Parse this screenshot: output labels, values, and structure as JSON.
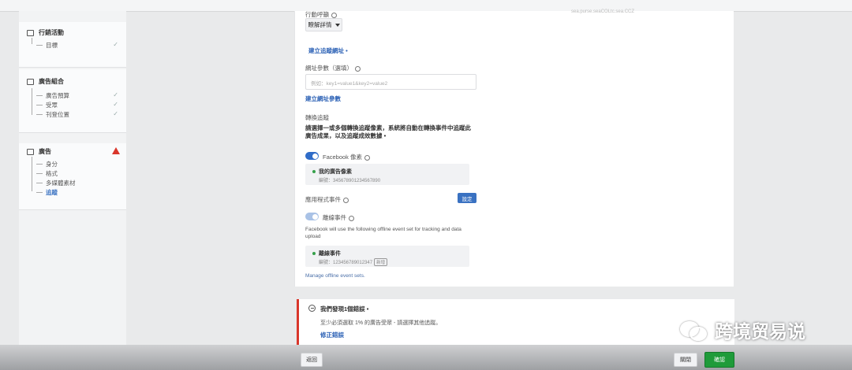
{
  "preview": {
    "caption": "sea.purse.seaCOLtc.sea.CCZ"
  },
  "sidebar": {
    "campaign": {
      "title": "行銷活動",
      "items": [
        {
          "label": "目標",
          "checked": true
        }
      ]
    },
    "adset": {
      "title": "廣告組合",
      "items": [
        {
          "label": "廣告預算",
          "checked": true
        },
        {
          "label": "受眾",
          "checked": true
        },
        {
          "label": "刊登位置",
          "checked": true
        }
      ]
    },
    "ad": {
      "title": "廣告",
      "warning": true,
      "items": [
        {
          "label": "身分"
        },
        {
          "label": "格式"
        },
        {
          "label": "多媒體素材"
        },
        {
          "label": "追蹤",
          "active": true
        }
      ]
    }
  },
  "form": {
    "top_label": "行動呼籲",
    "dropdown_value": "瞭解詳情",
    "show_more_link": "建立追蹤網址 •",
    "url_label": "網址參數（選填）",
    "url_placeholder": "例如：key1=value1&key2=value2",
    "url_params_link": "建立網址參數",
    "tracking_title": "轉換追蹤",
    "tracking_desc": "請選擇一或多個轉換追蹤像素，系統將自動在轉換事件中追蹤此廣告成果，以及追蹤成效數據 •",
    "pixel_toggle_label": "Facebook 像素",
    "pixel_toggle_on": true,
    "pixel_card": {
      "name": "我的廣告像素",
      "id": "編號：345678901234567890"
    },
    "app_events_label": "應用程式事件",
    "app_events_button": "設定",
    "offline_toggle_label": "離線事件",
    "offline_desc": "Facebook will use the following offline event set for tracking and data upload",
    "offline_card": {
      "name": "離線事件",
      "id": "編號：123456789012347",
      "chip": "新增"
    },
    "manage_link": "Manage offline event sets."
  },
  "error": {
    "title": "我們發現1個錯誤 •",
    "message": "至少必須選取 1% 的廣告受眾 - 請選擇其他追蹤。",
    "fix_link": "修正錯誤"
  },
  "footer": {
    "back_label": "返回",
    "close_label": "關閉",
    "confirm_label": "確認"
  },
  "watermark": {
    "text": "跨境贸易说"
  }
}
